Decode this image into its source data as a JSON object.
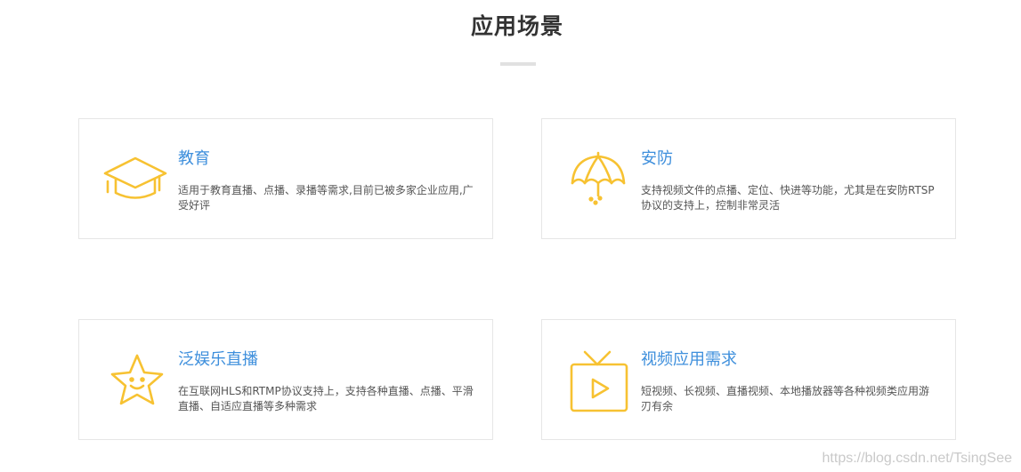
{
  "section": {
    "title": "应用场景"
  },
  "colors": {
    "icon": "#f7c232",
    "card_title": "#3e8fdc",
    "border": "#e6e6e6",
    "divider": "#e1e1e1"
  },
  "cards": [
    {
      "title": "教育",
      "description": "适用于教育直播、点播、录播等需求,目前已被多家企业应用,广受好评",
      "icon": "graduation-cap-icon"
    },
    {
      "title": "安防",
      "description": "支持视频文件的点播、定位、快进等功能，尤其是在安防RTSP协议的支持上，控制非常灵活",
      "icon": "umbrella-icon"
    },
    {
      "title": "泛娱乐直播",
      "description": "在互联网HLS和RTMP协议支持上，支持各种直播、点播、平滑直播、自适应直播等多种需求",
      "icon": "star-smile-icon"
    },
    {
      "title": "视频应用需求",
      "description": "短视频、长视频、直播视频、本地播放器等各种视频类应用游刃有余",
      "icon": "tv-play-icon"
    }
  ],
  "watermark": "https://blog.csdn.net/TsingSee"
}
